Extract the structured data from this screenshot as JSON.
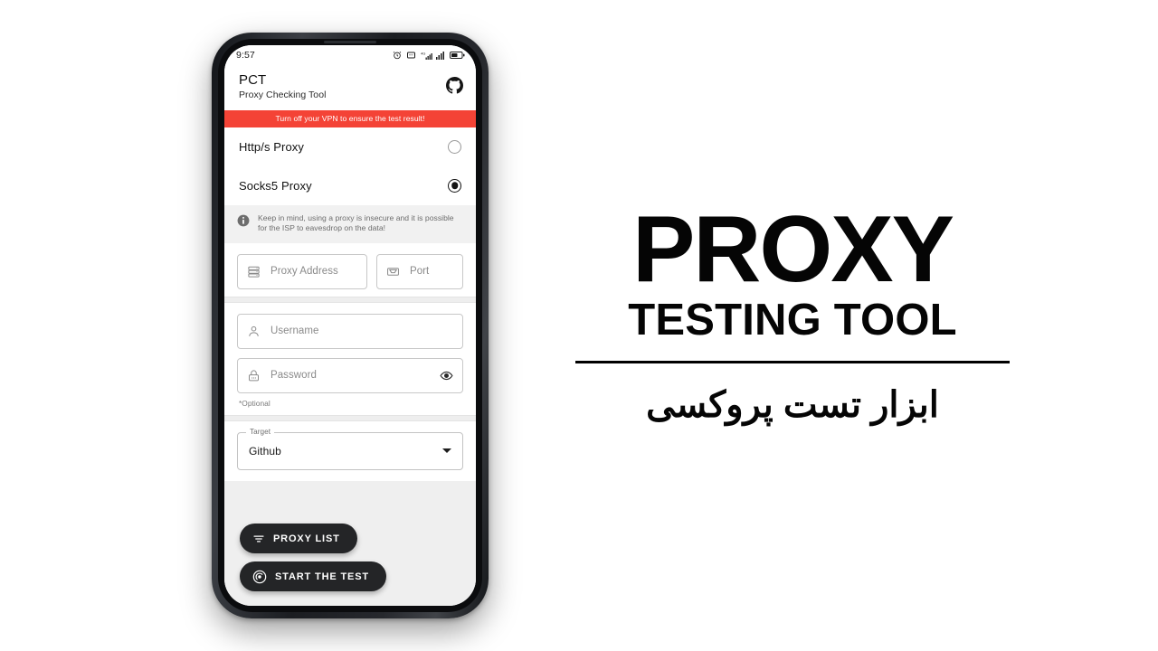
{
  "phone": {
    "status_bar": {
      "time": "9:57",
      "icons": [
        "alarm-icon",
        "vibrate-icon",
        "signal-data-icon",
        "signal-icon",
        "battery-icon"
      ]
    },
    "app_bar": {
      "title": "PCT",
      "subtitle": "Proxy Checking Tool",
      "action_icon": "github-icon"
    },
    "banner": {
      "text": "Turn off your VPN to ensure the test result!",
      "color": "#f44336"
    },
    "proxy_types": [
      {
        "label": "Http/s Proxy",
        "selected": false
      },
      {
        "label": "Socks5 Proxy",
        "selected": true
      }
    ],
    "info_note": {
      "icon": "info-icon",
      "text": "Keep in mind, using a proxy is insecure and it is possible for the ISP to eavesdrop on the data!"
    },
    "fields": {
      "proxy_address": {
        "placeholder": "Proxy Address",
        "value": "",
        "icon": "server-icon"
      },
      "port": {
        "placeholder": "Port",
        "value": "",
        "icon": "port-icon"
      },
      "username": {
        "placeholder": "Username",
        "value": "",
        "icon": "person-icon"
      },
      "password": {
        "placeholder": "Password",
        "value": "",
        "icon": "lock-icon",
        "trailing_icon": "eye-icon"
      },
      "optional_note": "*Optional"
    },
    "target": {
      "legend": "Target",
      "value": "Github",
      "caret_icon": "chevron-down-icon"
    },
    "buttons": [
      {
        "label": "PROXY LIST",
        "icon": "filter-icon"
      },
      {
        "label": "START THE TEST",
        "icon": "radar-icon"
      }
    ]
  },
  "brand": {
    "title": "PROXY",
    "subtitle": "TESTING TOOL",
    "farsi": "ابزار تست پروکسی"
  }
}
